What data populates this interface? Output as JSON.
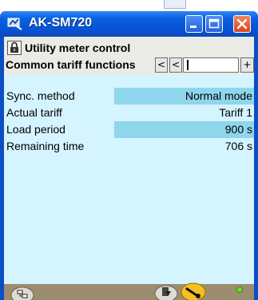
{
  "window": {
    "title": "AK-SM720"
  },
  "header": {
    "title": "Utility meter control",
    "nav_label": "Common tariff functions",
    "nav_first": "<",
    "nav_prev": "<",
    "nav_next": "+",
    "nav_value": ""
  },
  "rows": [
    {
      "label": "Sync. method",
      "value": "Normal mode"
    },
    {
      "label": "Actual tariff",
      "value": "Tariff 1"
    },
    {
      "label": "Load period",
      "value": "900 s"
    },
    {
      "label": "Remaining time",
      "value": "706 s"
    }
  ],
  "bottom": {
    "buttons": [
      "tree-icon",
      "download-icon",
      "wrench-icon"
    ],
    "status_led": "online"
  },
  "colors": {
    "titlebar": "#0754d6",
    "content_bg": "#d4f4ff",
    "row_highlight": "#8fd6ec",
    "bottom_bar": "#9c8d6f",
    "close_button": "#d9431c"
  }
}
